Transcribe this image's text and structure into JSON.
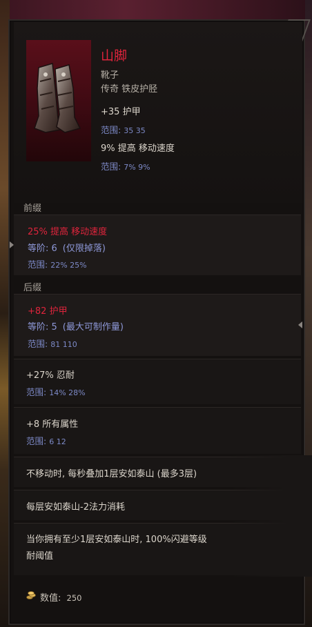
{
  "item": {
    "name": "山脚",
    "type": "靴子",
    "rarity": "传奇 铁皮护胫",
    "base_stats": [
      {
        "text": "+35 护甲",
        "range_label": "范围:",
        "range_values": "35  35"
      },
      {
        "text": "9% 提高 移动速度",
        "range_label": "范围:",
        "range_values": "7%  9%"
      }
    ]
  },
  "prefix": {
    "label": "前缀",
    "affixes": [
      {
        "text": "25% 提高 移动速度",
        "tier": "等阶: 6",
        "tier_note": "(仅限掉落)",
        "range_label": "范围:",
        "range_values": "22%  25%"
      }
    ]
  },
  "suffix": {
    "label": "后缀",
    "affixes": [
      {
        "text": "+82 护甲",
        "tier": "等阶: 5",
        "tier_note": "(最大可制作量)",
        "range_label": "范围:",
        "range_values": "81  110"
      }
    ]
  },
  "unique_mods": [
    {
      "text": "+27% 忍耐",
      "range_label": "范围:",
      "range_values": "14%  28%"
    },
    {
      "text": "+8 所有属性",
      "range_label": "范围:",
      "range_values": "6  12"
    }
  ],
  "special_effects": [
    "不移动时, 每秒叠加1层安如泰山 (最多3层)",
    "每层安如泰山-2法力消耗",
    "当你拥有至少1层安如泰山时, 100%闪避等级",
    "耐阈值"
  ],
  "footer": {
    "value_label": "数值:",
    "value": "250"
  },
  "colors": {
    "legendary_red": "#e0243c",
    "range_blue": "#7d8ac8",
    "tier_blue": "#8e98d8"
  },
  "icons": [
    "boots-item-icon",
    "coin-icon"
  ]
}
